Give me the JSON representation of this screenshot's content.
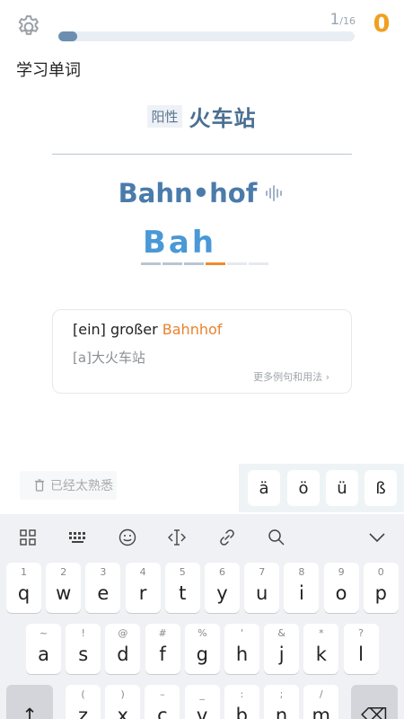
{
  "header": {
    "progress_current": "1",
    "progress_total": "/16",
    "progress_fraction": 0.0625,
    "score": "0"
  },
  "section_title": "学习单词",
  "word": {
    "gender": "阳性",
    "meaning": "火车站",
    "syllables": "Bahn•hof",
    "typed": "Bah",
    "slots_total": 6,
    "slots_done": 3
  },
  "example": {
    "prefix": "[ein] großer ",
    "highlight": "Bahnhof",
    "translation": "[a]大火车站",
    "more_link": "更多例句和用法 ›"
  },
  "familiar_label": "已经太熟悉",
  "umlauts": [
    "ä",
    "ö",
    "ü",
    "ß"
  ],
  "keyboard": {
    "row1": [
      {
        "hint": "1",
        "key": "q"
      },
      {
        "hint": "2",
        "key": "w"
      },
      {
        "hint": "3",
        "key": "e"
      },
      {
        "hint": "4",
        "key": "r"
      },
      {
        "hint": "5",
        "key": "t"
      },
      {
        "hint": "6",
        "key": "y"
      },
      {
        "hint": "7",
        "key": "u"
      },
      {
        "hint": "8",
        "key": "i"
      },
      {
        "hint": "9",
        "key": "o"
      },
      {
        "hint": "0",
        "key": "p"
      }
    ],
    "row2": [
      {
        "hint": "~",
        "key": "a"
      },
      {
        "hint": "!",
        "key": "s"
      },
      {
        "hint": "@",
        "key": "d"
      },
      {
        "hint": "#",
        "key": "f"
      },
      {
        "hint": "%",
        "key": "g"
      },
      {
        "hint": "'",
        "key": "h"
      },
      {
        "hint": "&",
        "key": "j"
      },
      {
        "hint": "*",
        "key": "k"
      },
      {
        "hint": "?",
        "key": "l"
      }
    ],
    "row3": [
      {
        "hint": "(",
        "key": "z"
      },
      {
        "hint": ")",
        "key": "x"
      },
      {
        "hint": "–",
        "key": "c"
      },
      {
        "hint": "_",
        "key": "v"
      },
      {
        "hint": ":",
        "key": "b"
      },
      {
        "hint": ";",
        "key": "n"
      },
      {
        "hint": "/",
        "key": "m"
      }
    ],
    "shift_label": "↑",
    "backspace_label": "⌫"
  }
}
